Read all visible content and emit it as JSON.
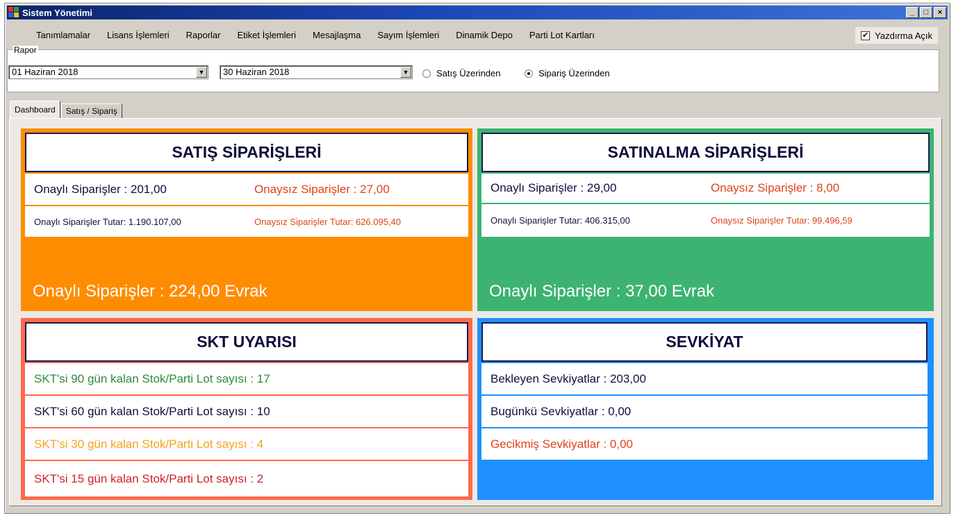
{
  "window": {
    "title": "Sistem Yönetimi",
    "controls": {
      "minimize": "_",
      "maximize": "□",
      "close": "×"
    }
  },
  "menu": {
    "items": [
      "Tanımlamalar",
      "Lisans İşlemleri",
      "Raporlar",
      "Etiket İşlemleri",
      "Mesajlaşma",
      "Sayım İşlemleri",
      "Dinamik Depo",
      "Parti Lot Kartları"
    ],
    "print_toggle": {
      "label": "Yazdırma Açık",
      "checked": true
    }
  },
  "report": {
    "legend": "Rapor",
    "date_start": "01 Haziran 2018",
    "date_end": "30 Haziran 2018",
    "options": [
      {
        "label": "Satış Üzerinden",
        "selected": false
      },
      {
        "label": "Sipariş Üzerinden",
        "selected": true
      }
    ]
  },
  "tabs": [
    {
      "label": "Dashboard",
      "active": true
    },
    {
      "label": "Satış / Sipariş",
      "active": false
    }
  ],
  "dashboard": {
    "sales": {
      "title": "SATIŞ SİPARİŞLERİ",
      "approved": "Onaylı Siparişler : 201,00",
      "unapproved": "Onaysız Siparişler : 27,00",
      "approved_total": "Onaylı Siparişler Tutar: 1.190.107,00",
      "unapproved_total": "Onaysız Siparişler Tutar: 626.095,40",
      "summary": "Onaylı Siparişler : 224,00 Evrak",
      "color": "#fe8c00"
    },
    "purchase": {
      "title": "SATINALMA SİPARİŞLERİ",
      "approved": "Onaylı Siparişler : 29,00",
      "unapproved": "Onaysız Siparişler : 8,00",
      "approved_total": "Onaylı Siparişler Tutar: 406.315,00",
      "unapproved_total": "Onaysız Siparişler Tutar: 99.496,59",
      "summary": "Onaylı Siparişler : 37,00 Evrak",
      "color": "#3cb371"
    },
    "skt": {
      "title": "SKT UYARISI",
      "rows": [
        "SKT'si 90 gün kalan Stok/Parti Lot sayısı : 17",
        "SKT'si 60 gün kalan Stok/Parti Lot sayısı : 10",
        "SKT'si 30 gün kalan Stok/Parti Lot sayısı : 4",
        "SKT'si 15 gün kalan Stok/Parti Lot sayısı : 2"
      ],
      "color": "#ff6a4d"
    },
    "shipment": {
      "title": "SEVKİYAT",
      "rows": [
        "Bekleyen Sevkiyatlar : 203,00",
        "Bugünkü Sevkiyatlar : 0,00",
        "Gecikmiş Sevkiyatlar : 0,00"
      ],
      "color": "#1e90ff"
    }
  }
}
